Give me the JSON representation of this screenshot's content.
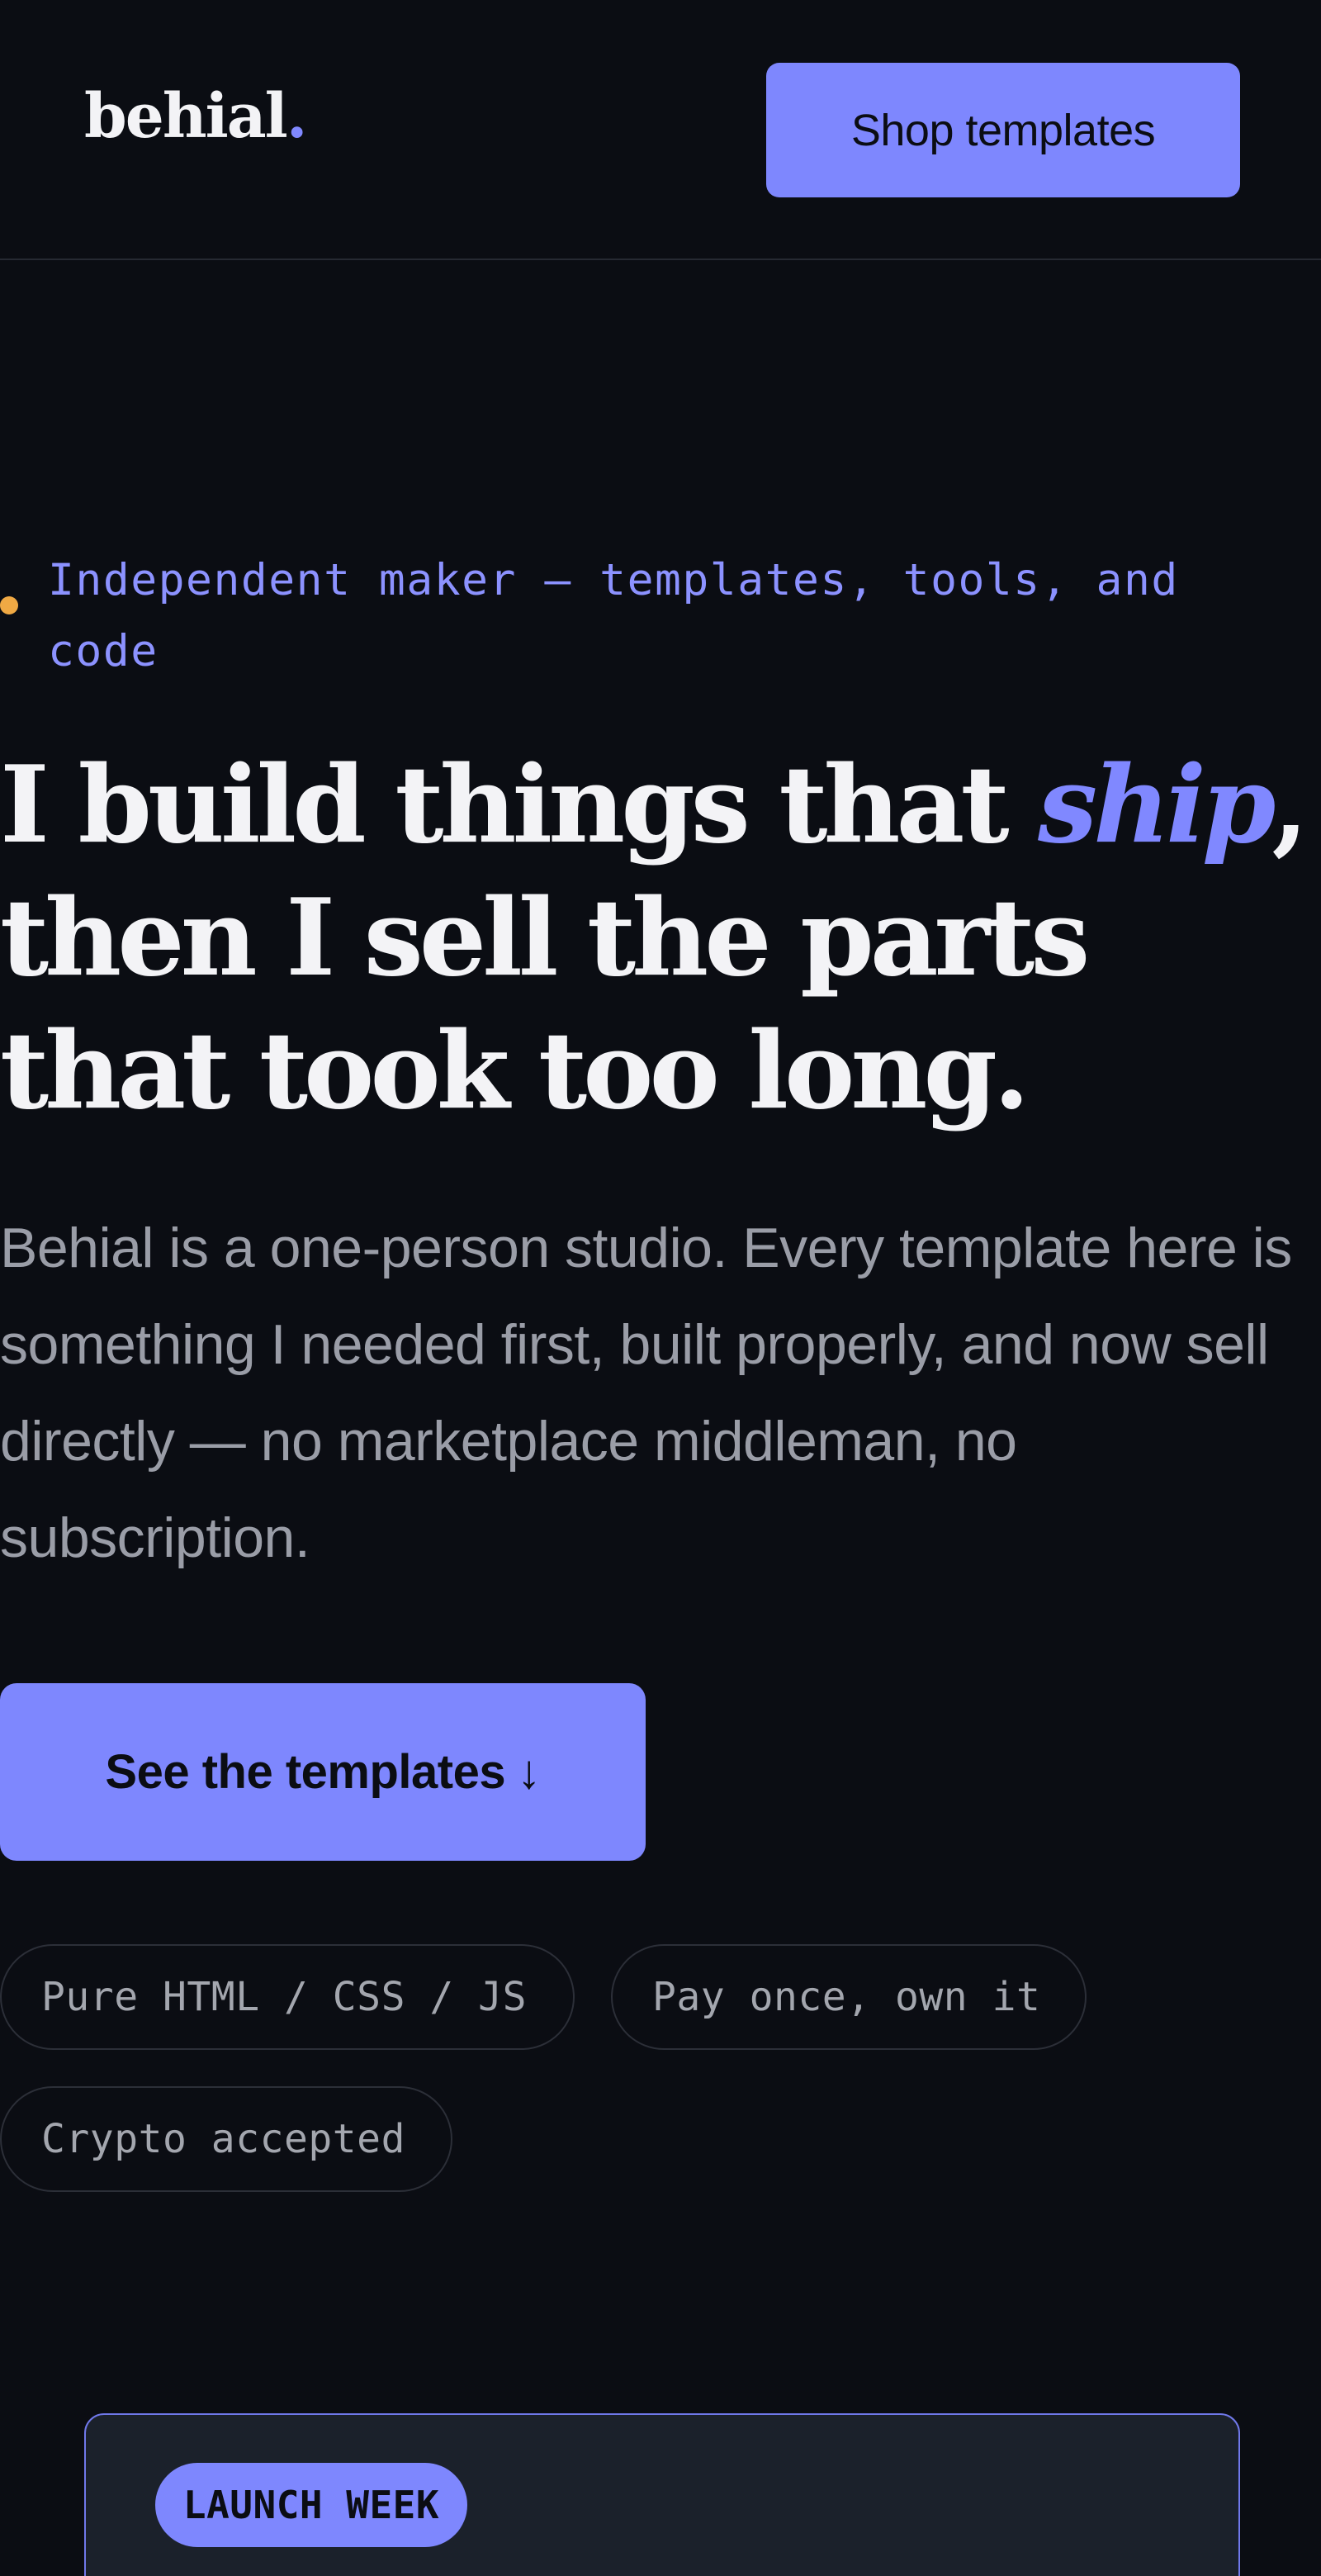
{
  "header": {
    "logo_text": "behial",
    "logo_dot": ".",
    "shop_button_label": "Shop templates"
  },
  "hero": {
    "eyebrow": "Independent maker — templates, tools, and code",
    "headline_before": "I build things that ",
    "headline_accent": "ship",
    "headline_after": ", then I sell the parts that took too long.",
    "lead": "Behial is a one-person studio. Every template here is something I needed first, built properly, and now sell directly — no marketplace middleman, no subscription.",
    "cta_label": "See the templates",
    "cta_icon": "↓"
  },
  "tags": [
    {
      "label": "Pure HTML / CSS / JS"
    },
    {
      "label": "Pay once, own it"
    },
    {
      "label": "Crypto accepted"
    }
  ],
  "launch_card": {
    "badge": "LAUNCH WEEK"
  },
  "colors": {
    "background": "#0b0d13",
    "accent": "#7e87fe",
    "eyebrow_dot": "#f0a944",
    "card_background": "#1b212b"
  }
}
